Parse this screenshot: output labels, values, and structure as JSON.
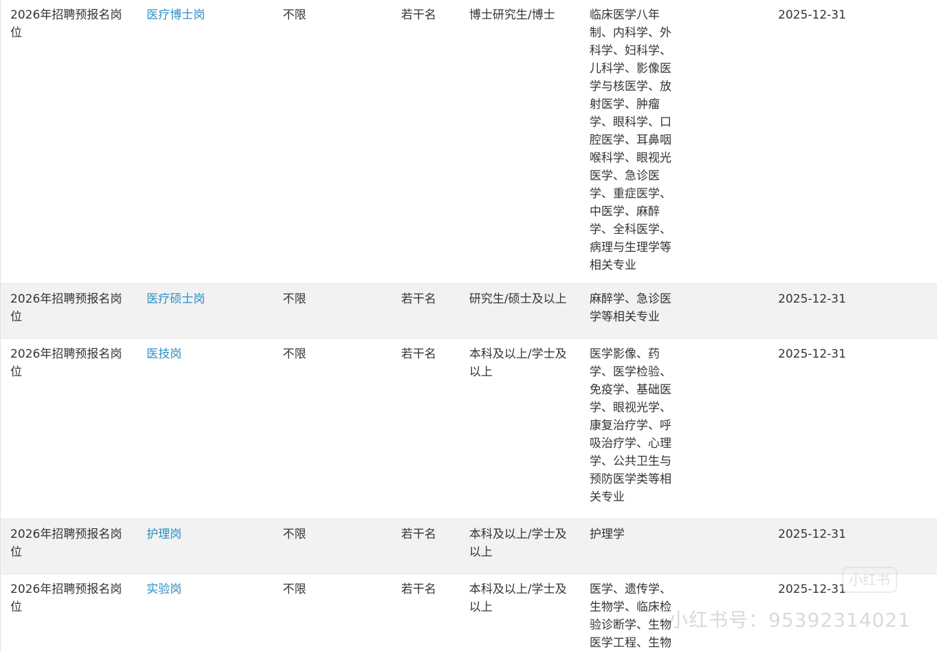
{
  "rows": [
    {
      "category": "2026年招聘预报名岗位",
      "position": "医疗博士岗",
      "age": "不限",
      "count": "若干名",
      "education": "博士研究生/博士",
      "major": "临床医学八年制、内科学、外科学、妇科学、儿科学、影像医学与核医学、放射医学、肿瘤学、眼科学、口腔医学、耳鼻咽喉科学、眼视光医学、急诊医学、重症医学、中医学、麻醉学、全科医学、病理与生理学等相关专业",
      "deadline": "2025-12-31"
    },
    {
      "category": "2026年招聘预报名岗位",
      "position": "医疗硕士岗",
      "age": "不限",
      "count": "若干名",
      "education": "研究生/硕士及以上",
      "major": "麻醉学、急诊医学等相关专业",
      "deadline": "2025-12-31"
    },
    {
      "category": "2026年招聘预报名岗位",
      "position": "医技岗",
      "age": "不限",
      "count": "若干名",
      "education": "本科及以上/学士及以上",
      "major": "医学影像、药学、医学检验、免疫学、基础医学、眼视光学、康复治疗学、呼吸治疗学、心理学、公共卫生与预防医学类等相关专业",
      "deadline": "2025-12-31"
    },
    {
      "category": "2026年招聘预报名岗位",
      "position": "护理岗",
      "age": "不限",
      "count": "若干名",
      "education": "本科及以上/学士及以上",
      "major": "护理学",
      "deadline": "2025-12-31"
    },
    {
      "category": "2026年招聘预报名岗位",
      "position": "实验岗",
      "age": "不限",
      "count": "若干名",
      "education": "本科及以上/学士及以上",
      "major": "医学、遗传学、生物学、临床检验诊断学、生物医学工程、生物",
      "deadline": "2025-12-31"
    }
  ],
  "watermark": {
    "logo": "小红书",
    "text": "小红书号：95392314021"
  }
}
